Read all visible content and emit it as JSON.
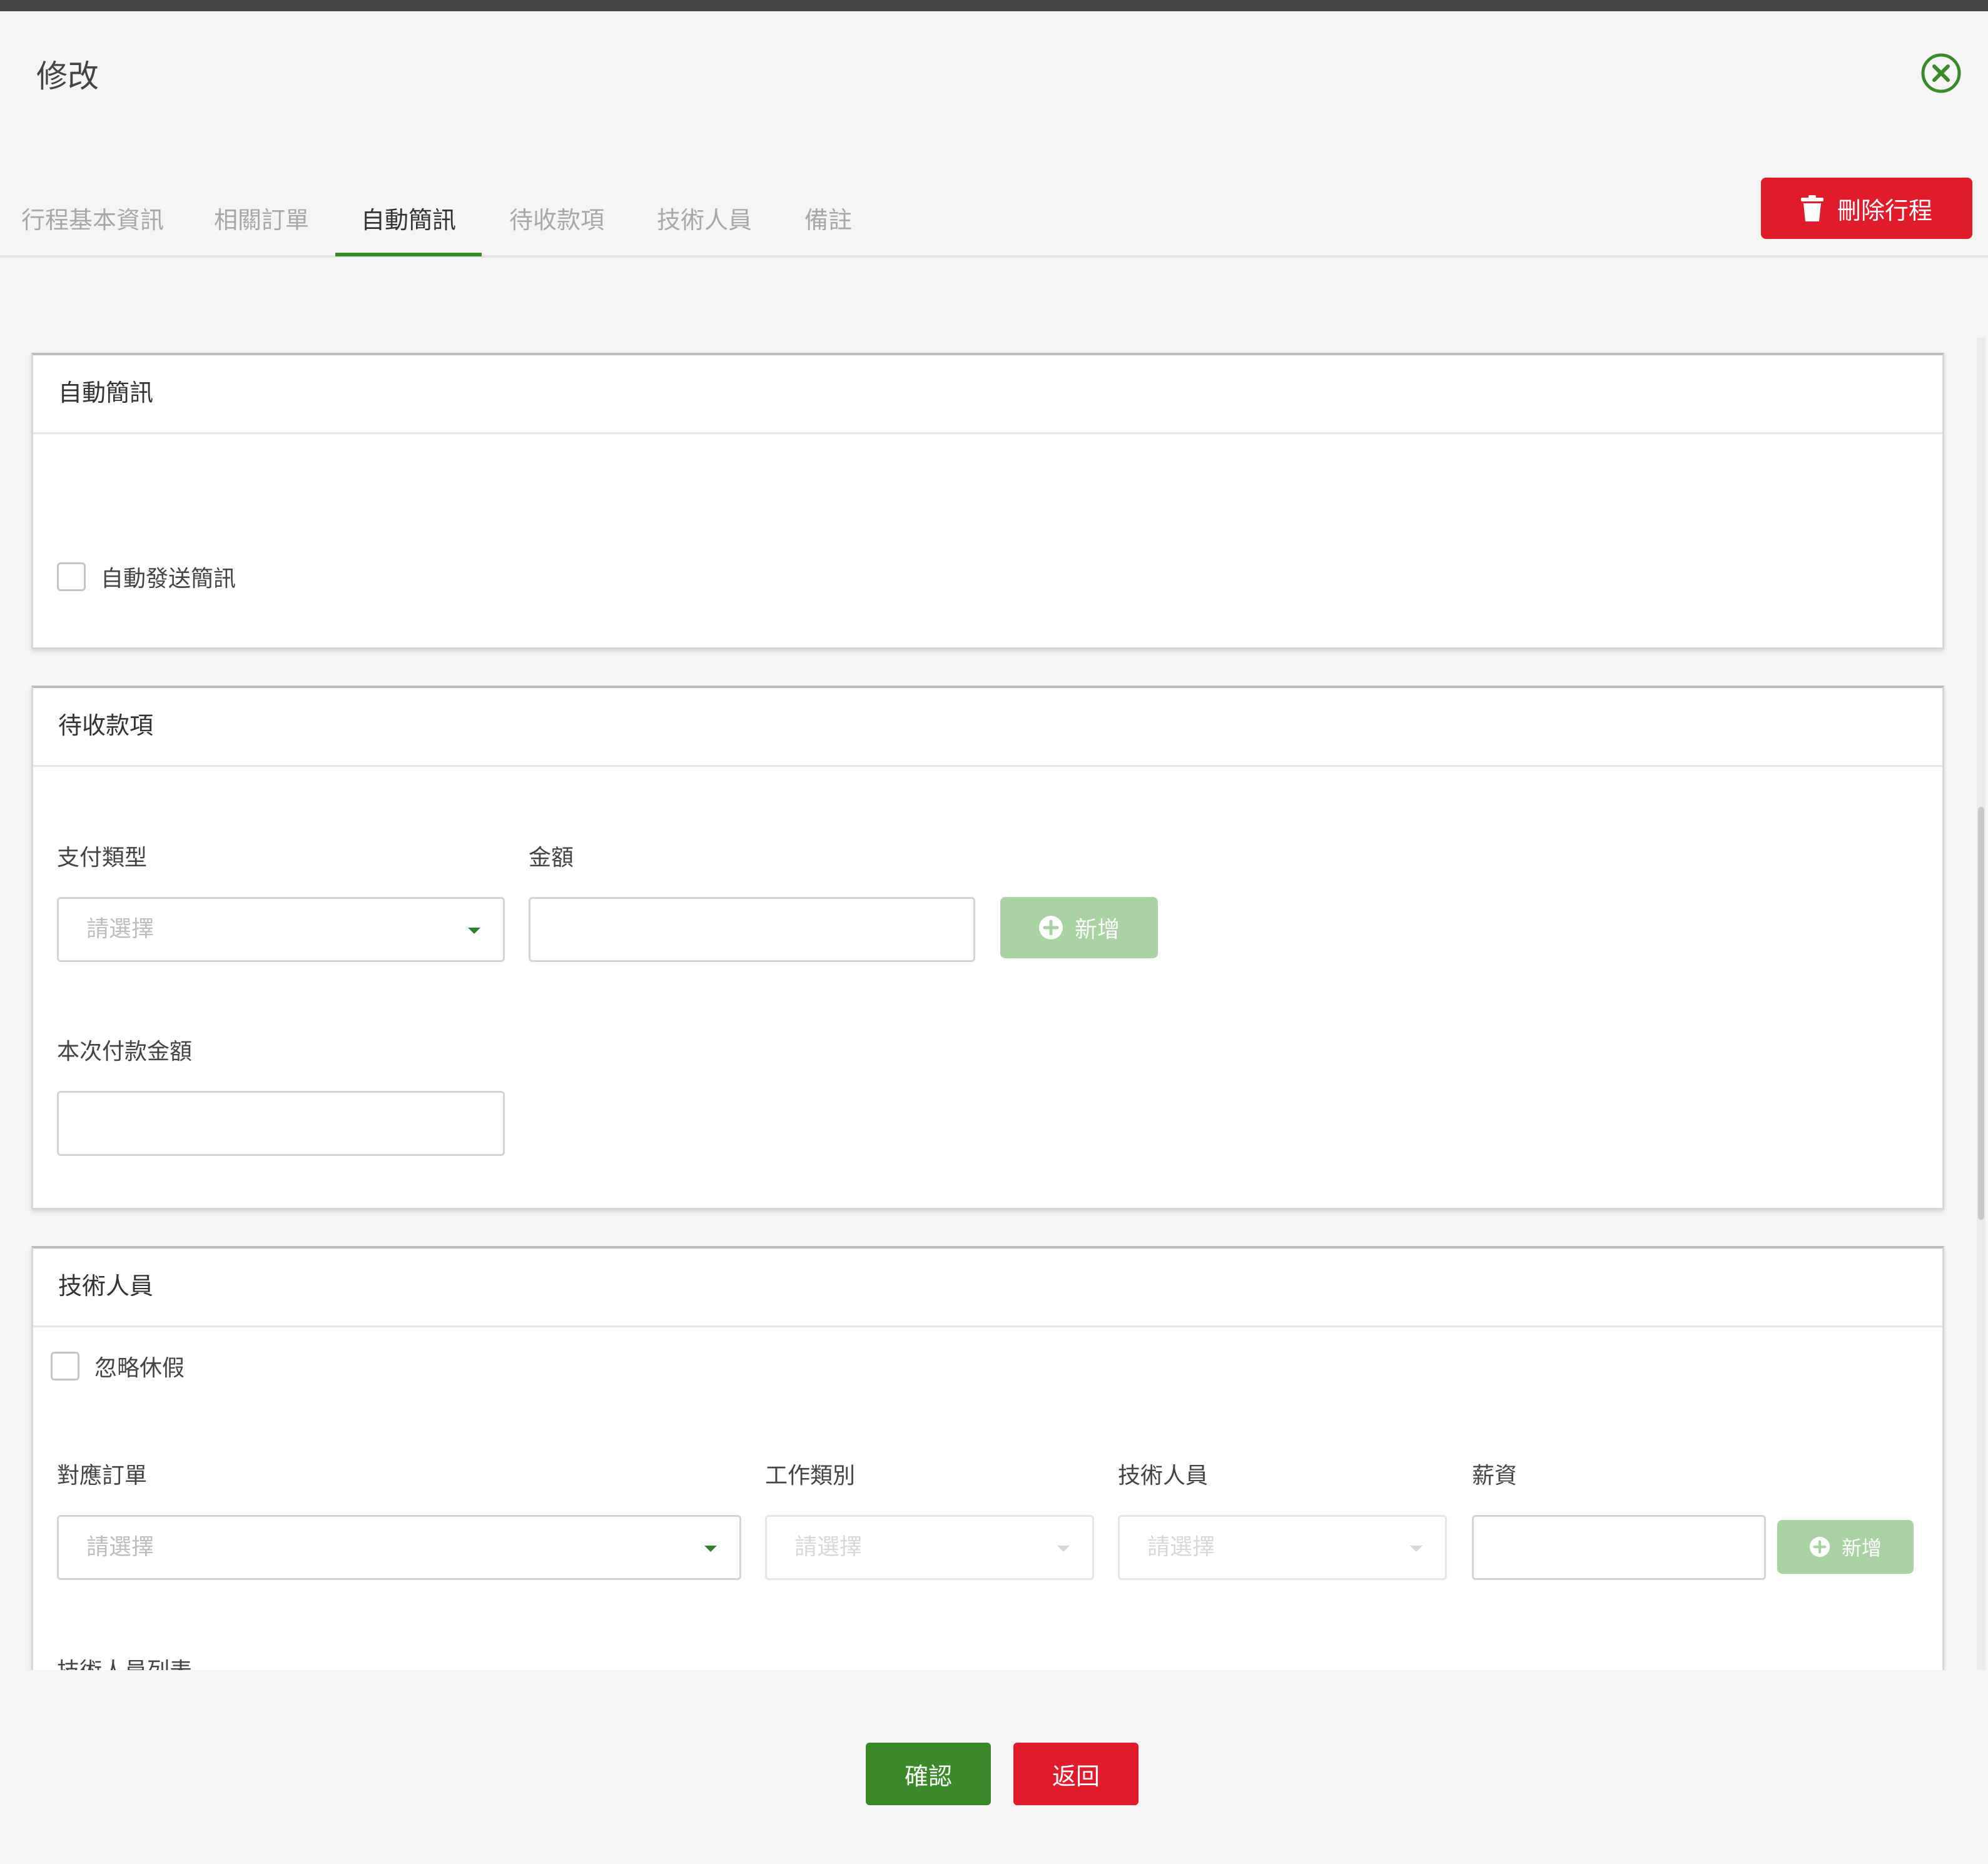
{
  "modal": {
    "title": "修改",
    "close_icon": "close-circle-icon"
  },
  "tabs": [
    {
      "label": "行程基本資訊",
      "active": false
    },
    {
      "label": "相關訂單",
      "active": false
    },
    {
      "label": "自動簡訊",
      "active": true
    },
    {
      "label": "待收款項",
      "active": false
    },
    {
      "label": "技術人員",
      "active": false
    },
    {
      "label": "備註",
      "active": false
    }
  ],
  "delete_button": {
    "label": "刪除行程",
    "icon": "trash-icon"
  },
  "sms_panel": {
    "title": "自動簡訊",
    "checkbox_label": "自動發送簡訊",
    "checked": false
  },
  "receivable_panel": {
    "title": "待收款項",
    "payment_type": {
      "label": "支付類型",
      "placeholder": "請選擇"
    },
    "amount": {
      "label": "金額",
      "value": ""
    },
    "add_label": "新增",
    "this_payment": {
      "label": "本次付款金額",
      "value": ""
    }
  },
  "tech_panel": {
    "title": "技術人員",
    "ignore_holiday_label": "忽略休假",
    "ignore_holiday_checked": false,
    "order": {
      "label": "對應訂單",
      "placeholder": "請選擇"
    },
    "job_type": {
      "label": "工作類別",
      "placeholder": "請選擇"
    },
    "technician": {
      "label": "技術人員",
      "placeholder": "請選擇"
    },
    "salary": {
      "label": "薪資",
      "value": ""
    },
    "add_label": "新增",
    "list_label": "技術人員列表"
  },
  "footer": {
    "confirm_label": "確認",
    "back_label": "返回"
  },
  "colors": {
    "accent_green": "#3a8a2a",
    "danger_red": "#e01b2b",
    "disabled_green": "#a9d3a3"
  }
}
